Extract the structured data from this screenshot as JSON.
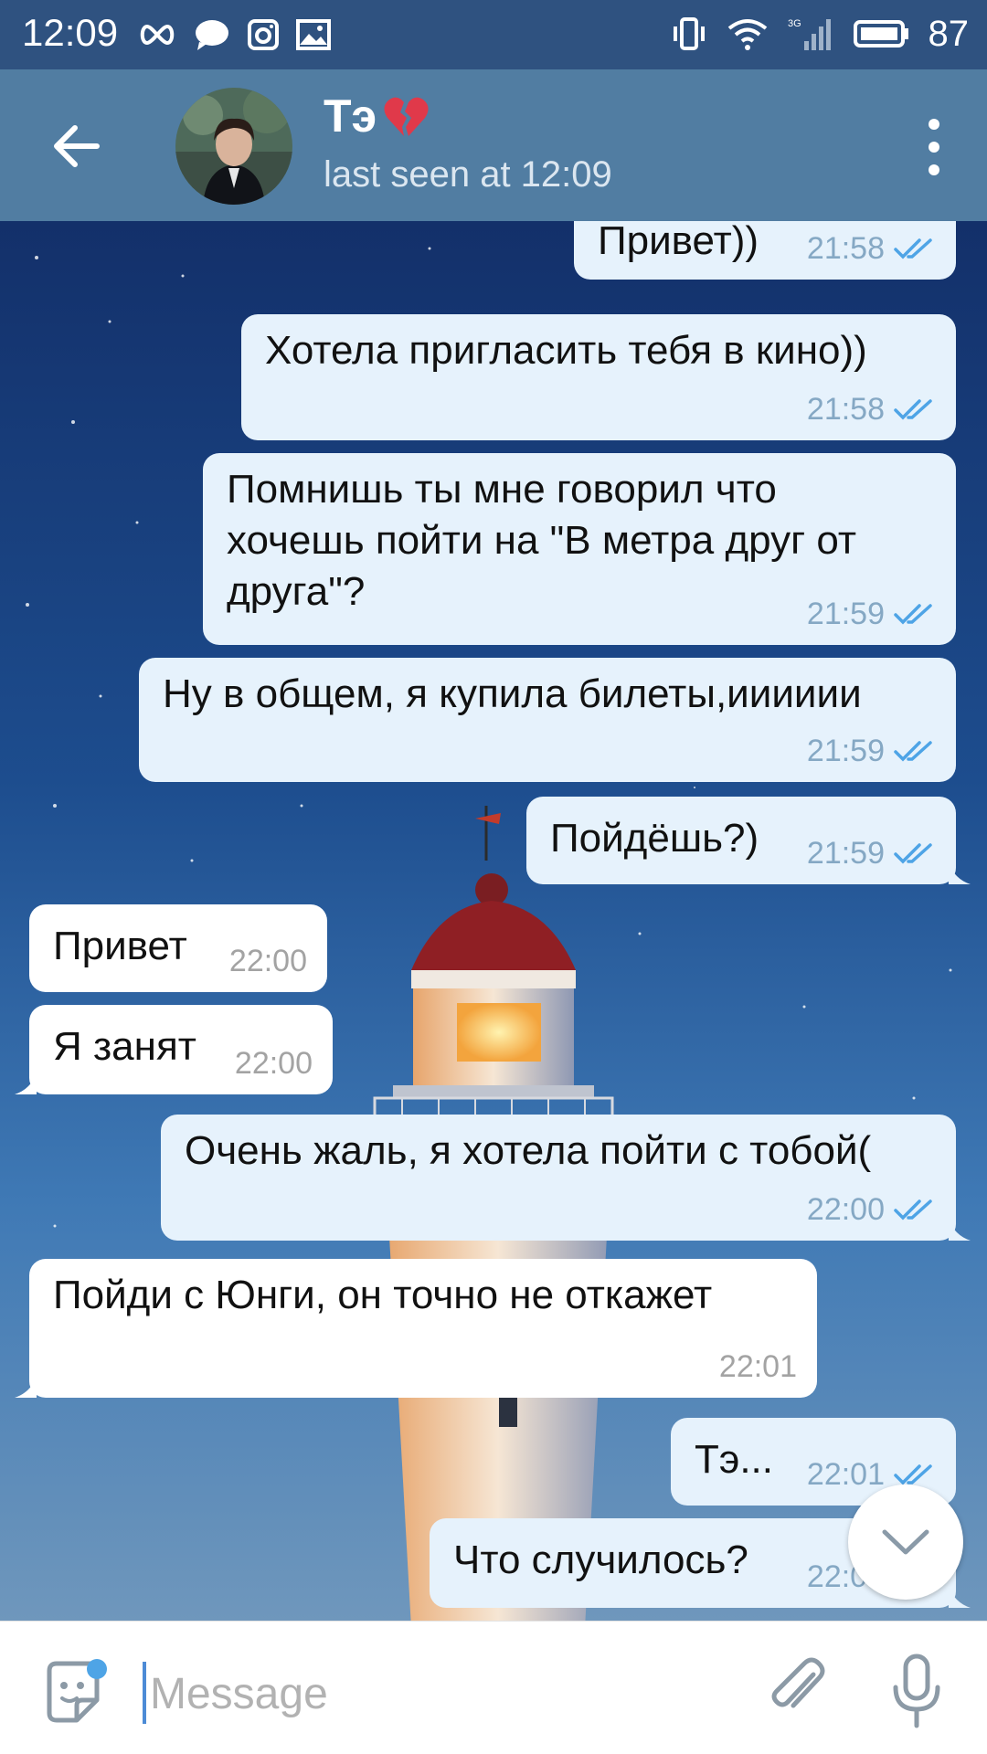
{
  "status_bar": {
    "time": "12:09",
    "battery": "87",
    "network": "3G"
  },
  "header": {
    "name": "Тэ",
    "status": "last seen at 12:09"
  },
  "messages": [
    {
      "dir": "out",
      "text": "Привет))",
      "time": "21:58"
    },
    {
      "dir": "out",
      "text": "Хотела пригласить тебя в кино))",
      "time": "21:58"
    },
    {
      "dir": "out",
      "lines": [
        "Помнишь ты мне говорил что",
        "хочешь пойти на \"В метра друг от",
        "друга\"?"
      ],
      "time": "21:59"
    },
    {
      "dir": "out",
      "text": "Ну в общем, я купила билеты,ииииии",
      "time": "21:59"
    },
    {
      "dir": "out",
      "text": "Пойдёшь?)",
      "time": "21:59"
    },
    {
      "dir": "in",
      "text": "Привет",
      "time": "22:00"
    },
    {
      "dir": "in",
      "text": "Я занят",
      "time": "22:00"
    },
    {
      "dir": "out",
      "text": "Очень жаль, я хотела пойти с тобой(",
      "time": "22:00"
    },
    {
      "dir": "in",
      "text": "Пойди с Юнги, он точно не откажет",
      "time": "22:01"
    },
    {
      "dir": "out",
      "text": "Тэ...",
      "time": "22:01"
    },
    {
      "dir": "out",
      "text": "Что случилось?",
      "time": "22:01"
    }
  ],
  "input": {
    "placeholder": "Message"
  },
  "icons": {
    "back": "arrow-left-icon",
    "menu": "more-vertical-icon",
    "sticker": "sticker-icon",
    "attach": "paperclip-icon",
    "mic": "microphone-icon",
    "scroll": "chevron-down-icon",
    "heart": "broken-heart-icon"
  },
  "colors": {
    "header": "#517da2",
    "status_bar": "#2f5280",
    "bubble_out": "#e6f2fc",
    "bubble_in": "#ffffff",
    "check": "#4ea4e6"
  }
}
